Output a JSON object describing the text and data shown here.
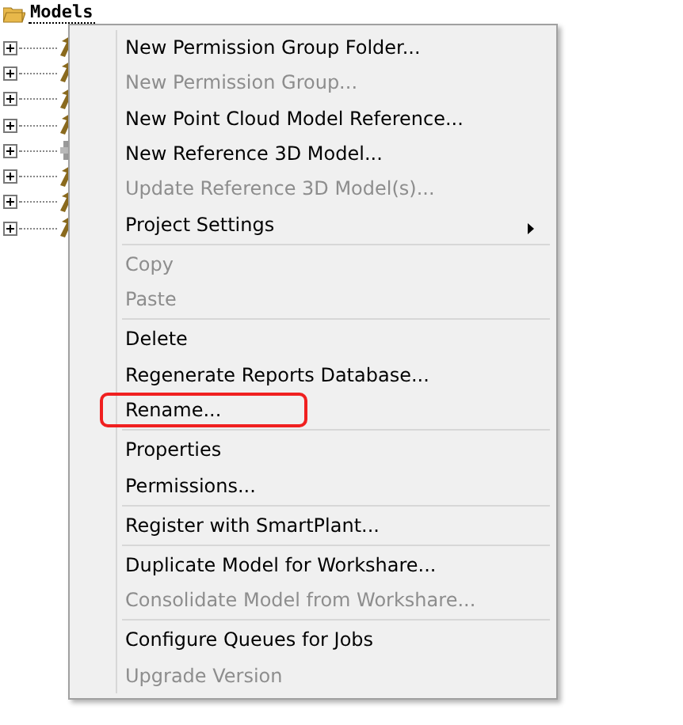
{
  "tree": {
    "root": {
      "label": "Models",
      "expanded": true
    },
    "children": [
      {
        "kind": "model",
        "expanded": false
      },
      {
        "kind": "model",
        "expanded": false
      },
      {
        "kind": "model",
        "expanded": false
      },
      {
        "kind": "model",
        "expanded": false
      },
      {
        "kind": "reference",
        "expanded": false
      },
      {
        "kind": "model",
        "expanded": false
      },
      {
        "kind": "model",
        "expanded": false
      },
      {
        "kind": "model",
        "expanded": false
      }
    ]
  },
  "context_menu": {
    "groups": [
      [
        {
          "label": "New Permission Group Folder...",
          "disabled": false
        },
        {
          "label": "New Permission Group...",
          "disabled": true
        },
        {
          "label": "New Point Cloud Model Reference...",
          "disabled": false
        },
        {
          "label": "New Reference 3D Model...",
          "disabled": false
        },
        {
          "label": "Update Reference 3D Model(s)...",
          "disabled": true
        },
        {
          "label": "Project Settings",
          "disabled": false,
          "submenu": true
        }
      ],
      [
        {
          "label": "Copy",
          "disabled": true
        },
        {
          "label": "Paste",
          "disabled": true
        }
      ],
      [
        {
          "label": "Delete",
          "disabled": false
        },
        {
          "label": "Regenerate Reports Database...",
          "disabled": false
        },
        {
          "label": "Rename...",
          "disabled": false,
          "highlighted": true
        }
      ],
      [
        {
          "label": "Properties",
          "disabled": false
        },
        {
          "label": "Permissions...",
          "disabled": false
        }
      ],
      [
        {
          "label": "Register with SmartPlant...",
          "disabled": false
        }
      ],
      [
        {
          "label": "Duplicate Model for Workshare...",
          "disabled": false
        },
        {
          "label": "Consolidate Model from Workshare...",
          "disabled": true
        }
      ],
      [
        {
          "label": "Configure Queues for Jobs",
          "disabled": false
        },
        {
          "label": "Upgrade Version",
          "disabled": true
        }
      ]
    ]
  }
}
